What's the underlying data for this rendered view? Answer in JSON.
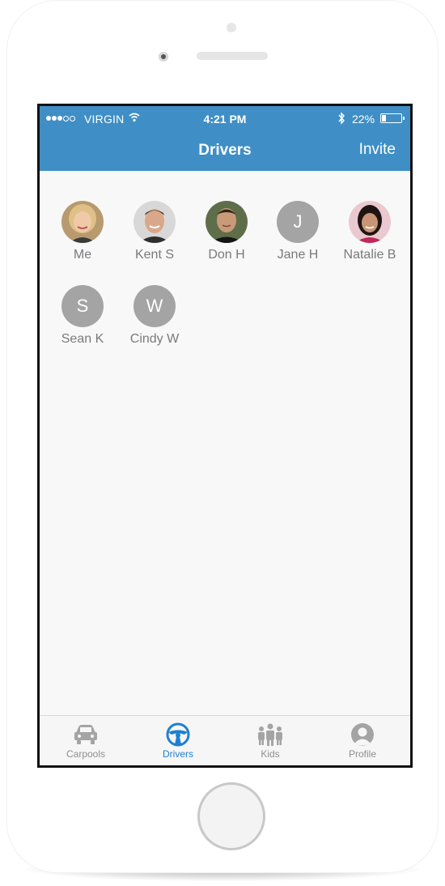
{
  "status_bar": {
    "carrier": "VIRGIN",
    "time": "4:21 PM",
    "battery_percent": "22%",
    "battery_level": 0.22,
    "signal_bars_filled": 3,
    "signal_bars_total": 5
  },
  "nav": {
    "title": "Drivers",
    "invite_label": "Invite"
  },
  "drivers": [
    {
      "name": "Me",
      "initial": "",
      "type": "photo"
    },
    {
      "name": "Kent S",
      "initial": "",
      "type": "photo"
    },
    {
      "name": "Don H",
      "initial": "",
      "type": "photo"
    },
    {
      "name": "Jane H",
      "initial": "J",
      "type": "letter"
    },
    {
      "name": "Natalie B",
      "initial": "",
      "type": "photo"
    },
    {
      "name": "Sean K",
      "initial": "S",
      "type": "letter"
    },
    {
      "name": "Cindy W",
      "initial": "W",
      "type": "letter"
    }
  ],
  "tabs": [
    {
      "label": "Carpools",
      "icon": "car-icon",
      "active": false
    },
    {
      "label": "Drivers",
      "icon": "steering-wheel-icon",
      "active": true
    },
    {
      "label": "Kids",
      "icon": "kids-icon",
      "active": false
    },
    {
      "label": "Profile",
      "icon": "profile-icon",
      "active": false
    }
  ],
  "colors": {
    "accent": "#3f8fc6",
    "active_tab": "#1d80d1",
    "inactive": "#a4a4a4"
  }
}
